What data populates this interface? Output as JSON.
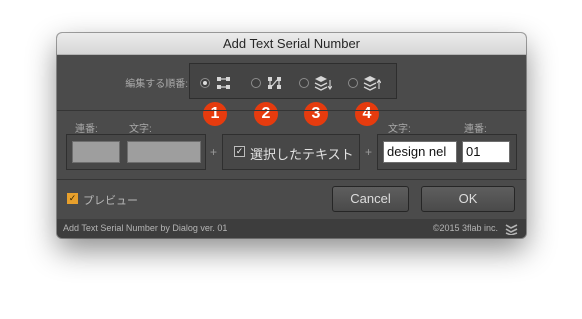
{
  "window": {
    "title": "Add Text Serial Number"
  },
  "order": {
    "label": "編集する順番:",
    "options": [
      {
        "icon": "serial-then-text-icon",
        "selected": true
      },
      {
        "icon": "text-then-serial-icon",
        "selected": false
      },
      {
        "icon": "layers-down-icon",
        "selected": false
      },
      {
        "icon": "layers-up-icon",
        "selected": false
      }
    ],
    "badges": [
      "1",
      "2",
      "3",
      "4"
    ]
  },
  "left_group": {
    "serial_label": "連番:",
    "text_label": "文字:",
    "serial_value": "",
    "text_value": ""
  },
  "middle": {
    "checkbox_checked": true,
    "label": "選択したテキスト"
  },
  "right_group": {
    "text_label": "文字:",
    "serial_label": "連番:",
    "text_value": "design nel",
    "serial_value": "01"
  },
  "plus_sign": "+",
  "preview": {
    "label": "プレビュー",
    "checked": true
  },
  "buttons": {
    "cancel": "Cancel",
    "ok": "OK"
  },
  "footer": {
    "left": "Add Text Serial Number by Dialog ver. 01",
    "right": "©2015 3flab inc."
  },
  "colors": {
    "badge": "#e63b0e",
    "checkbox_accent": "#e8a02c",
    "panel_bg": "#4b4b4b"
  }
}
